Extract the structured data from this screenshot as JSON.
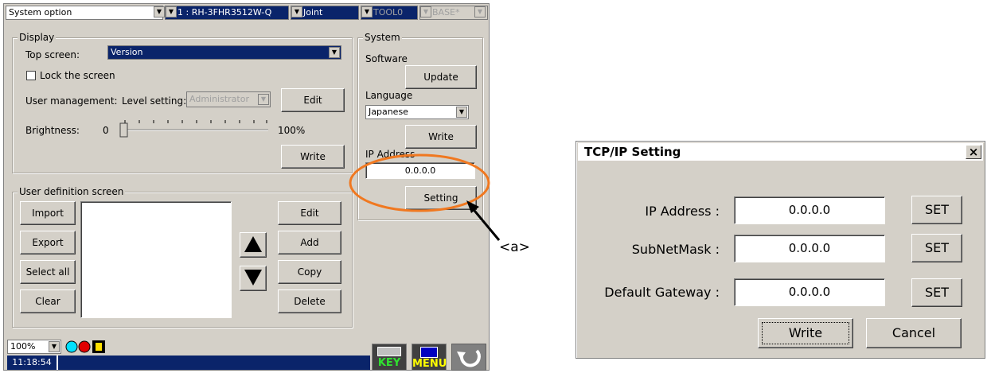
{
  "toolbar": {
    "screen_select": "System option",
    "robot_select": "1 : RH-3FHR3512W-Q",
    "jog_mode": "Joint",
    "tool": "TOOL0",
    "base": "BASE*"
  },
  "display": {
    "title": "Display",
    "top_screen_label": "Top screen:",
    "top_screen_value": "Version",
    "lock_screen_label": "Lock the screen",
    "user_mgmt_label": "User management:",
    "level_label": "Level setting:",
    "level_value": "Administrator",
    "edit_label": "Edit",
    "brightness_label": "Brightness:",
    "brightness_min": "0",
    "brightness_max": "100%",
    "brightness_value": 0,
    "write_label": "Write"
  },
  "user_def": {
    "title": "User definition screen",
    "import_label": "Import",
    "export_label": "Export",
    "select_all_label": "Select all",
    "clear_label": "Clear",
    "edit_label": "Edit",
    "add_label": "Add",
    "copy_label": "Copy",
    "delete_label": "Delete"
  },
  "system": {
    "title": "System",
    "software_label": "Software",
    "update_label": "Update",
    "language_label": "Language",
    "language_value": "Japanese",
    "write_label": "Write",
    "ip_label": "IP Address",
    "ip_value": "0.0.0.0",
    "setting_label": "Setting"
  },
  "footer": {
    "zoom": "100%",
    "time": "11:18:54",
    "key_label": "KEY",
    "menu_label": "MENU"
  },
  "callout": {
    "label": "<a>",
    "color": "#f07820"
  },
  "dialog": {
    "title": "TCP/IP Setting",
    "close": "×",
    "ip_label": "IP Address :",
    "ip_value": "0.0.0.0",
    "subnet_label": "SubNetMask :",
    "subnet_value": "0.0.0.0",
    "gateway_label": "Default Gateway :",
    "gateway_value": "0.0.0.0",
    "set_label": "SET",
    "write_label": "Write",
    "cancel_label": "Cancel"
  }
}
